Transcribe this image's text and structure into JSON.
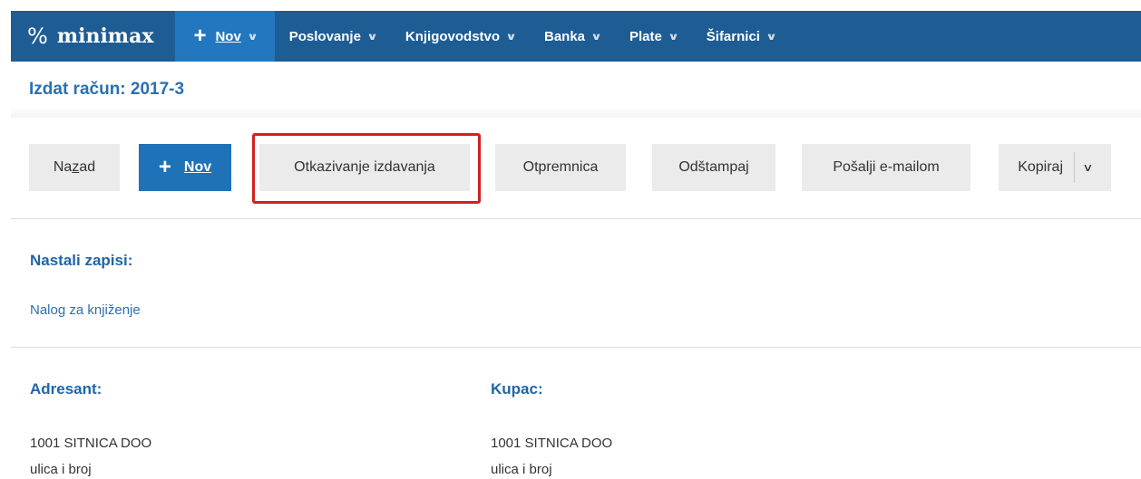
{
  "nav": {
    "logo_text": "minimax",
    "logo_mark": "%",
    "new_label": "Nov",
    "items": [
      {
        "label": "Poslovanje"
      },
      {
        "label": "Knjigovodstvo"
      },
      {
        "label": "Banka"
      },
      {
        "label": "Plate"
      },
      {
        "label": "Šifarnici"
      }
    ]
  },
  "page": {
    "title": "Izdat račun: 2017-3"
  },
  "toolbar": {
    "back_prefix": "Na",
    "back_underlined": "z",
    "back_suffix": "ad",
    "new_label": "Nov",
    "cancel_issue": "Otkazivanje izdavanja",
    "delivery_note": "Otpremnica",
    "print": "Odštampaj",
    "send_email": "Pošalji e-mailom",
    "copy": "Kopiraj"
  },
  "records": {
    "heading": "Nastali zapisi:",
    "link": "Nalog za knjiženje"
  },
  "sender": {
    "heading": "Adresant:",
    "name": "1001 SITNICA DOO",
    "address": "ulica i broj"
  },
  "customer": {
    "heading": "Kupac:",
    "name": "1001 SITNICA DOO",
    "address": "ulica i broj"
  },
  "colors": {
    "nav_bg": "#1e5d94",
    "nav_active": "#2377bf",
    "primary": "#1e72b8",
    "highlight": "#d42020",
    "heading": "#1f66a6"
  }
}
